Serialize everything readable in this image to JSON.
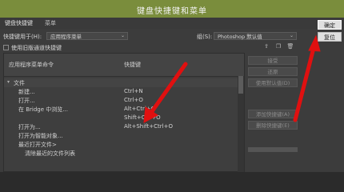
{
  "dialog": {
    "title": "键盘快捷键和菜单"
  },
  "tabs": [
    {
      "label": "键盘快捷键"
    },
    {
      "label": "菜单"
    }
  ],
  "shortcuts_for": {
    "label": "快捷键用于(H):",
    "value": "应用程序菜单",
    "set_label": "组(S):",
    "set_value": "Photoshop 默认值"
  },
  "legacy_checkbox": {
    "label": "使用旧版通道快捷键"
  },
  "list": {
    "col_command": "应用程序菜单命令",
    "col_shortcut": "快捷键",
    "items": [
      {
        "icon": "▾",
        "label": "文件",
        "shortcut": "",
        "group": true
      },
      {
        "label": "新建...",
        "shortcut": "Ctrl+N"
      },
      {
        "label": "打开...",
        "shortcut": "Ctrl+O"
      },
      {
        "label": "在 Bridge 中浏览...",
        "shortcut": "Alt+Ctrl+O"
      },
      {
        "label": "",
        "shortcut": "Shift+Ctrl+O"
      },
      {
        "label": "打开为...",
        "shortcut": "Alt+Shift+Ctrl+O"
      },
      {
        "label": "打开为智能对象...",
        "shortcut": ""
      },
      {
        "label": "最近打开文件>",
        "shortcut": ""
      },
      {
        "label": "清除最近的文件列表",
        "shortcut": ""
      }
    ]
  },
  "right_buttons": [
    {
      "label": "接受"
    },
    {
      "label": "还原"
    },
    {
      "label": "使用默认值(D)"
    },
    {
      "label": "添加快捷键(A)"
    },
    {
      "label": "删除快捷键(E)"
    }
  ],
  "dialog_buttons": {
    "ok": "确定",
    "reset": "复位"
  },
  "annotation_color": "#e01010"
}
